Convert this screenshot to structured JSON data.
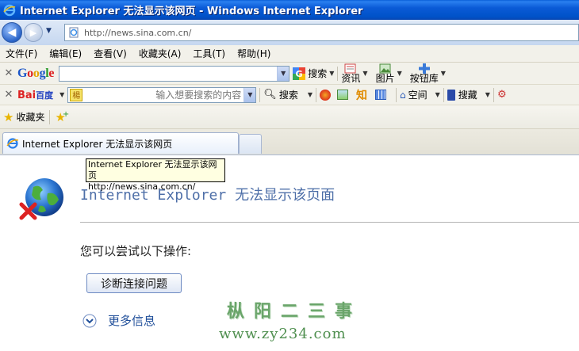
{
  "window": {
    "title": "Internet Explorer 无法显示该网页 - Windows Internet Explorer"
  },
  "address": {
    "url": "http://news.sina.com.cn/"
  },
  "menu": [
    "文件(F)",
    "编辑(E)",
    "查看(V)",
    "收藏夹(A)",
    "工具(T)",
    "帮助(H)"
  ],
  "google_bar": {
    "logo": "Google",
    "search_label": "搜索",
    "news_label": "资讯",
    "images_label": "图片",
    "buttons_label": "按钮库"
  },
  "baidu_bar": {
    "logo_text": "Bai",
    "logo_cn": "百度",
    "placeholder": "输入想要搜索的内容",
    "search_label": "搜索",
    "zhi_label": "知",
    "space_label": "空间",
    "bookmark_label": "搜藏"
  },
  "favorites_bar": {
    "favorites_label": "收藏夹"
  },
  "tab": {
    "title": "Internet Explorer 无法显示该网页"
  },
  "tooltip": {
    "line1": "Internet Explorer 无法显示该网页",
    "line2": "http://news.sina.com.cn/"
  },
  "content": {
    "heading": "Internet Explorer 无法显示该页面",
    "message": "您可以尝试以下操作:",
    "diagnose_button": "诊断连接问题",
    "more_info": "更多信息"
  },
  "watermark": {
    "line1": "枞阳二三事",
    "line2": "www.zy234.com"
  }
}
